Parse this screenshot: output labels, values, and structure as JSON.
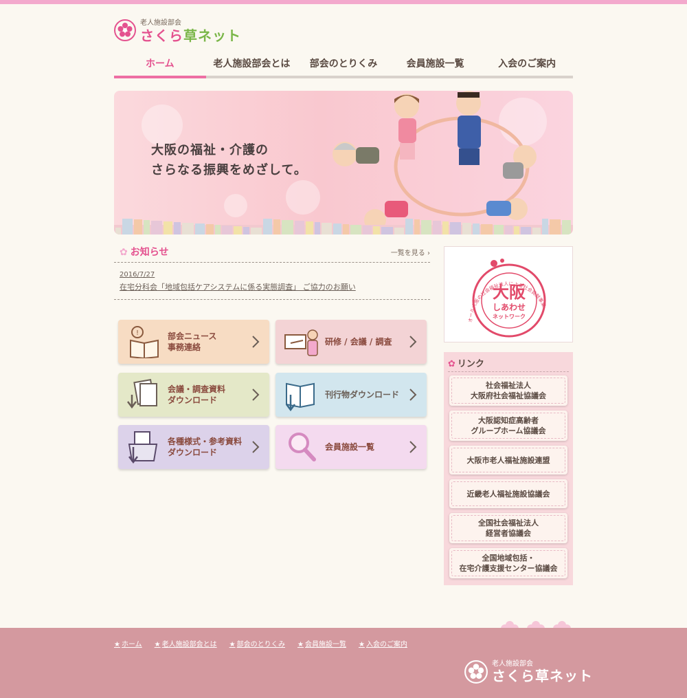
{
  "colors": {
    "accent": "#e4528f",
    "brand_green": "#7ab648",
    "footer": "#d4999f",
    "background": "#fbf8f1"
  },
  "header": {
    "logo_sub": "老人施設部会",
    "logo_pre": "さくら",
    "logo_mid": "草",
    "logo_post": "ネット",
    "nav": [
      "ホーム",
      "老人施設部会とは",
      "部会のとりくみ",
      "会員施設一覧",
      "入会のご案内"
    ]
  },
  "hero": {
    "line1": "大阪の福祉・介護の",
    "line2": "さらなる振興をめざして。"
  },
  "news": {
    "title": "お知らせ",
    "more": "一覧を見る",
    "items": [
      {
        "date": "2016/7/27",
        "text": "在宅分科会「地域包括ケアシステムに係る実態調査」 ご協力のお願い"
      }
    ]
  },
  "menu": [
    {
      "label": "部会ニュース\n事務連絡",
      "icon": "newspaper-icon"
    },
    {
      "label": "研修 / 会議 / 調査",
      "icon": "lecturer-icon"
    },
    {
      "label": "会議・調査資料\nダウンロード",
      "icon": "documents-download-icon"
    },
    {
      "label": "刊行物ダウンロード",
      "icon": "book-download-icon"
    },
    {
      "label": "各種様式・参考資料\nダウンロード",
      "icon": "folder-download-icon"
    },
    {
      "label": "会員施設一覧",
      "icon": "magnifier-icon"
    }
  ],
  "badge": {
    "main": "大阪",
    "sub": "しあわせ",
    "sub2": "ネットワーク",
    "ring": "オール大阪の社会福祉法人による社会貢献事業"
  },
  "links": {
    "title": "リンク",
    "items": [
      "社会福祉法人\n大阪府社会福祉協議会",
      "大阪認知症高齢者\nグループホーム協議会",
      "大阪市老人福祉施設連盟",
      "近畿老人福祉施設協議会",
      "全国社会福祉法人\n経営者協議会",
      "全国地域包括・\n在宅介護支援センター協議会"
    ]
  },
  "footer": {
    "nav": [
      "ホーム",
      "老人施設部会とは",
      "部会のとりくみ",
      "会員施設一覧",
      "入会のご案内"
    ],
    "logo_sub": "老人施設部会",
    "logo_main": "さくら草ネット"
  }
}
